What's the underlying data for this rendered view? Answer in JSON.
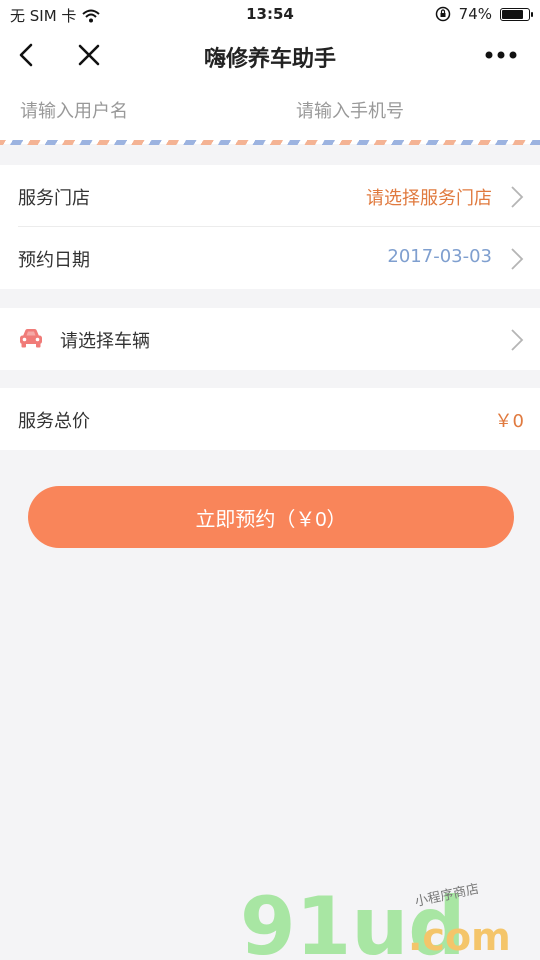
{
  "status_bar": {
    "carrier": "无 SIM 卡",
    "time": "13:54",
    "battery_text": "74%",
    "battery_level": 0.74
  },
  "nav": {
    "title": "嗨修养车助手"
  },
  "contact": {
    "username_placeholder": "请输入用户名",
    "phone_placeholder": "请输入手机号"
  },
  "appointment": {
    "store_label": "服务门店",
    "store_value": "请选择服务门店",
    "date_label": "预约日期",
    "date_value": "2017-03-03"
  },
  "vehicle": {
    "label": "请选择车辆"
  },
  "price": {
    "label": "服务总价",
    "value": "￥0"
  },
  "submit": {
    "label": "立即预约（￥0）"
  },
  "watermark": {
    "brand": "91ud",
    "domain": ".com",
    "tagline": "小程序商店"
  },
  "colors": {
    "accent": "#f9855a",
    "store_value": "#e07a3f",
    "date_value": "#7f9fcf",
    "price_value": "#e07a3f",
    "car_icon": "#f07b78"
  }
}
